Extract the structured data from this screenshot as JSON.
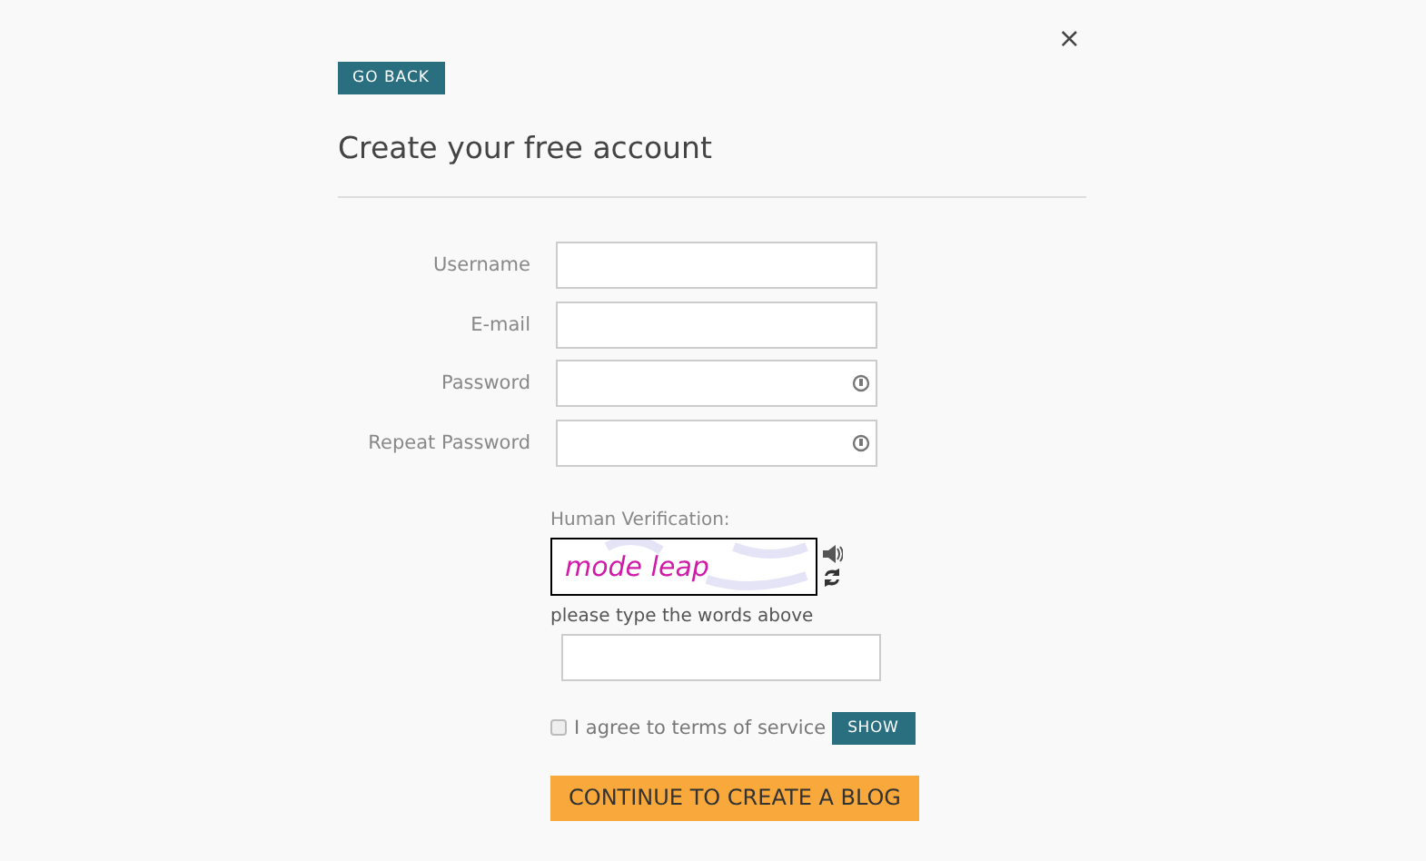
{
  "close_label": "×",
  "back_button": "GO BACK",
  "title": "Create your free account",
  "fields": [
    {
      "label": "Username",
      "kind": "text"
    },
    {
      "label": "E-mail",
      "kind": "text"
    },
    {
      "label": "Password",
      "kind": "password"
    },
    {
      "label": "Repeat Password",
      "kind": "password"
    }
  ],
  "verification": {
    "label": "Human Verification:",
    "captcha": "mode leap",
    "hint": "please type the words above"
  },
  "terms": {
    "label": "I agree to terms of service",
    "checked": false,
    "button": "SHOW"
  },
  "submit": "CONTINUE TO CREATE A BLOG"
}
